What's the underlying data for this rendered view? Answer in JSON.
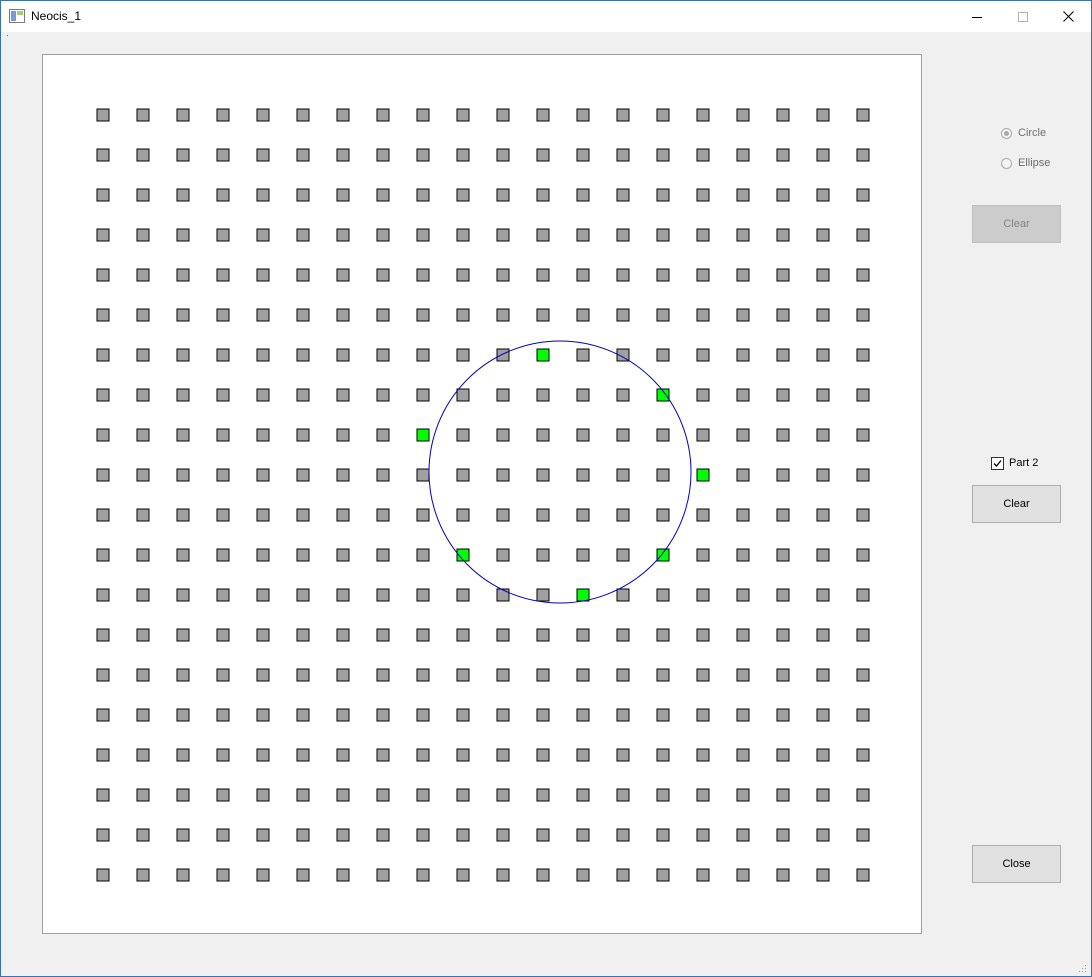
{
  "window": {
    "title": "Neocis_1",
    "controls": [
      "minimize-icon",
      "maximize-icon",
      "close-icon"
    ]
  },
  "grid": {
    "rows": 20,
    "cols": 20,
    "cell_color": "#a0a0a0",
    "highlight_color": "#00ff00",
    "highlighted": [
      [
        6,
        11
      ],
      [
        7,
        14
      ],
      [
        8,
        8
      ],
      [
        9,
        15
      ],
      [
        11,
        9
      ],
      [
        11,
        14
      ],
      [
        12,
        12
      ]
    ]
  },
  "circle": {
    "stroke_color": "#0000c0"
  },
  "controls": {
    "circle_label": "Circle",
    "ellipse_label": "Ellipse",
    "mode_selected": "Circle",
    "clear_top_label": "Clear",
    "part2_label": "Part 2",
    "part2_checked": true,
    "clear_part2_label": "Clear",
    "close_label": "Close"
  }
}
